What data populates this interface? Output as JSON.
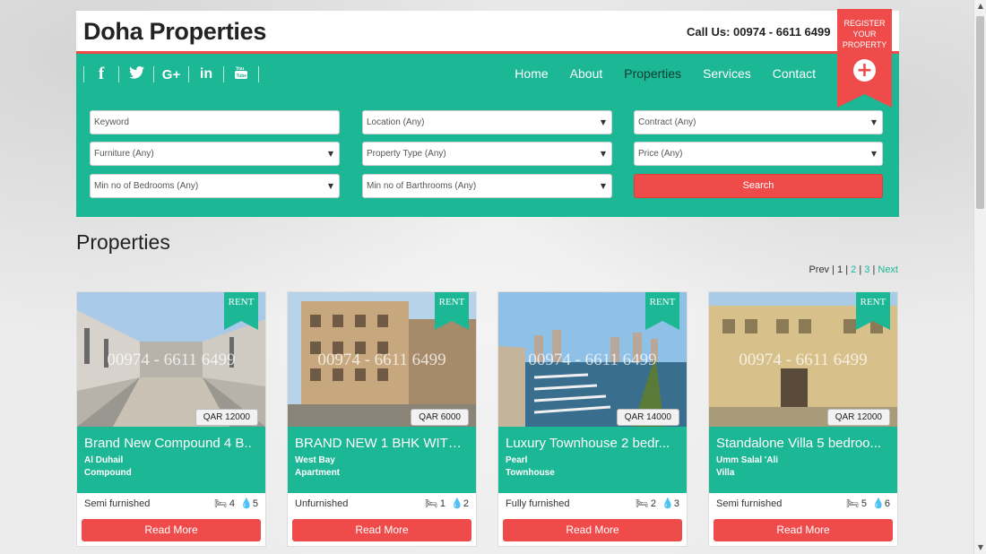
{
  "header": {
    "logo": "Doha Properties",
    "call_us": "Call Us: 00974 - 6611 6499"
  },
  "register": {
    "lines": [
      "REGISTER",
      "YOUR",
      "PROPERTY"
    ],
    "icon": "plus-icon"
  },
  "social": [
    {
      "name": "facebook-icon",
      "glyph": "f"
    },
    {
      "name": "twitter-icon",
      "glyph": "t"
    },
    {
      "name": "google-plus-icon",
      "glyph": "G+"
    },
    {
      "name": "linkedin-icon",
      "glyph": "in"
    },
    {
      "name": "youtube-icon",
      "glyph": "You"
    }
  ],
  "nav": {
    "items": [
      "Home",
      "About",
      "Properties",
      "Services",
      "Contact"
    ],
    "active": "Properties"
  },
  "search": {
    "keyword": "Keyword",
    "location": "Location (Any)",
    "contract": "Contract (Any)",
    "furniture": "Furniture (Any)",
    "property_type": "Property Type (Any)",
    "price": "Price (Any)",
    "bedrooms": "Min no of Bedrooms (Any)",
    "bathrooms": "Min no of Barthrooms (Any)",
    "button": "Search"
  },
  "main": {
    "heading": "Properties"
  },
  "pager": {
    "prev": "Prev",
    "current": "1",
    "p2": "2",
    "p3": "3",
    "next": "Next",
    "sep": " | "
  },
  "watermark": "00974 - 6611 6499",
  "listings": [
    {
      "badge": "RENT",
      "price": "QAR 12000",
      "title": "Brand New Compound 4 B..",
      "location": "Al Duhail",
      "type": "Compound",
      "furnishing": "Semi furnished",
      "beds": "4",
      "baths": "5",
      "cta": "Read More"
    },
    {
      "badge": "RENT",
      "price": "QAR 6000",
      "title": "BRAND NEW 1 BHK WITH...",
      "location": "West Bay",
      "type": "Apartment",
      "furnishing": "Unfurnished",
      "beds": "1",
      "baths": "2",
      "cta": "Read More"
    },
    {
      "badge": "RENT",
      "price": "QAR 14000",
      "title": "Luxury Townhouse 2 bedr...",
      "location": "Pearl",
      "type": "Townhouse",
      "furnishing": "Fully furnished",
      "beds": "2",
      "baths": "3",
      "cta": "Read More"
    },
    {
      "badge": "RENT",
      "price": "QAR 12000",
      "title": "Standalone Villa 5 bedroo...",
      "location": "Umm Salal 'Ali",
      "type": "Villa",
      "furnishing": "Semi furnished",
      "beds": "5",
      "baths": "6",
      "cta": "Read More"
    }
  ],
  "colors": {
    "accent": "#1cb794",
    "brand_red": "#ef4b4b"
  }
}
